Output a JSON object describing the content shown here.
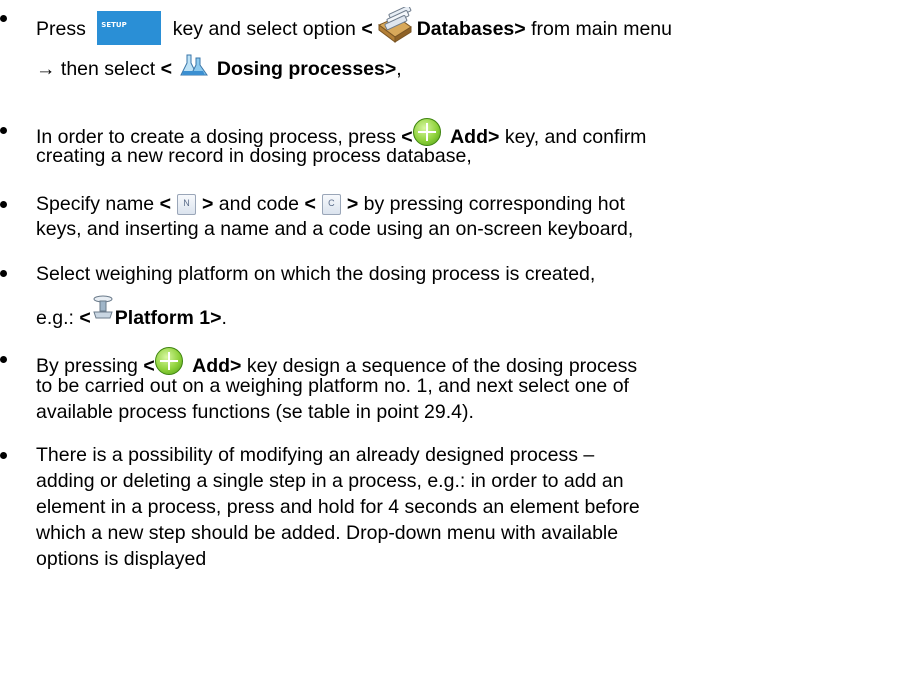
{
  "bullets": [
    {
      "line1": {
        "press": "Press",
        "setup_key_label": "SETUP",
        "mid": "key and select option",
        "open": "<",
        "databases": "Databases>",
        "tail": "from main menu"
      },
      "line2": {
        "arrow": "→ then select",
        "open": "<",
        "dosing": "Dosing processes>",
        "tail": ","
      }
    },
    {
      "line1": {
        "pre": "In order to create a dosing process, press",
        "open": "<",
        "add": "Add>",
        "tail": "key, and confirm"
      },
      "line2": "creating a new record in dosing process database,"
    },
    {
      "line1": {
        "pre": "Specify name",
        "open1": "<",
        "close1": ">",
        "mid": "and code",
        "open2": "<",
        "close2": ">",
        "tail": "by pressing corresponding hot"
      },
      "line2": "keys, and inserting a name and a code using an on-screen keyboard,"
    },
    {
      "line1": "Select weighing platform on which the dosing process is created,",
      "line2": {
        "pre": "e.g.:",
        "open": "<",
        "platform": "Platform 1>",
        "tail": "."
      }
    },
    {
      "line1": {
        "pre": "By pressing",
        "open": "<",
        "add": "Add>",
        "tail": "key design a sequence of the dosing process"
      },
      "line2": "to be carried out on a weighing platform no. 1, and next select one of",
      "line3": "available process functions (se table in point 29.4)."
    },
    {
      "line1": "There is a possibility of modifying an already designed process –",
      "line2": "adding or deleting a single step in a process, e.g.: in order to add an",
      "line3": "element in a process, press and hold for 4 seconds an element before",
      "line4": "which a new step should be added. Drop-down menu with available",
      "line5": "options is displayed"
    }
  ],
  "icons": [
    "setup-key-icon",
    "databases-icon",
    "dosing-processes-icon",
    "add-icon",
    "name-icon",
    "code-icon",
    "platform-icon"
  ],
  "colors": {
    "setup_key": "#2a8fd6",
    "add_icon": "#8fd23b"
  }
}
